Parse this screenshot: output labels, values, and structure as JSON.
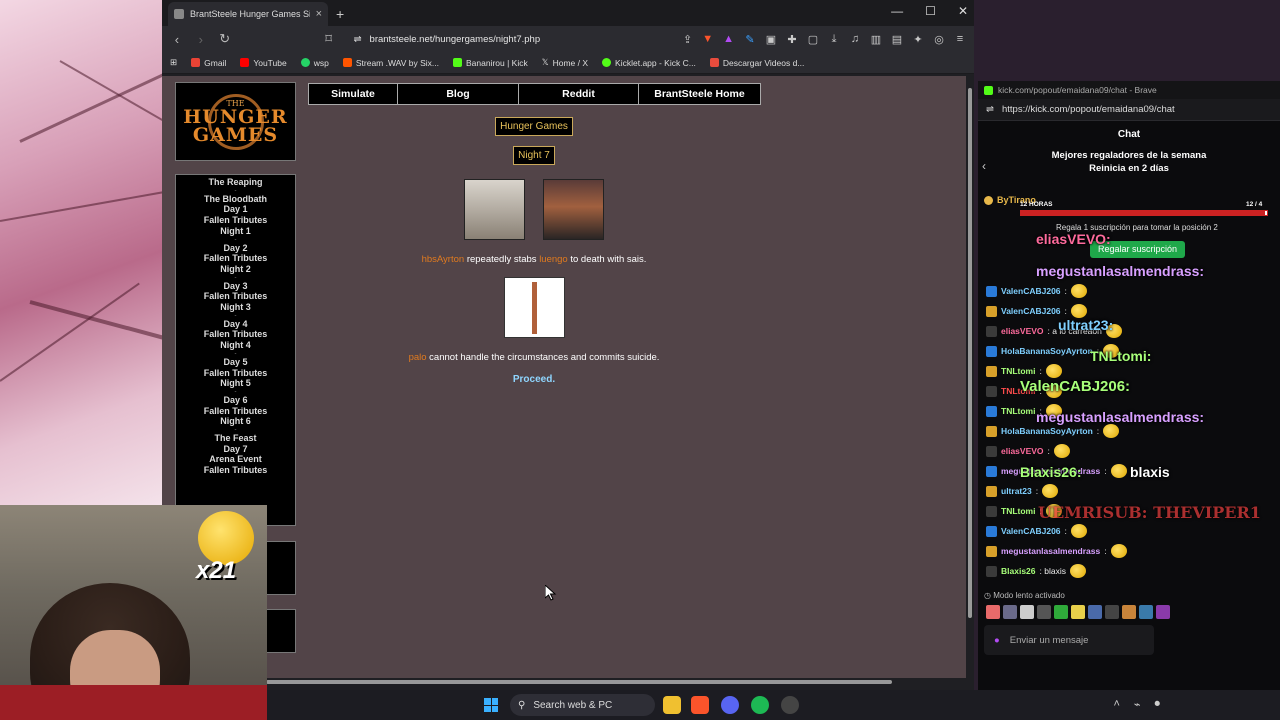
{
  "browser": {
    "tab_title": "BrantSteele Hunger Games Simu",
    "tab_close": "×",
    "new_tab": "+",
    "window_controls": [
      "—",
      "☐",
      "✕"
    ],
    "url": "brantsteele.net/hungergames/night7.php",
    "bookmarks": [
      {
        "label": "Gmail",
        "color": "#ea4335"
      },
      {
        "label": "YouTube",
        "color": "#ff0000"
      },
      {
        "label": "wsp",
        "color": "#25d366"
      },
      {
        "label": "Stream .WAV by Six...",
        "color": "#ff5500"
      },
      {
        "label": "Bananirou | Kick",
        "color": "#53fc18"
      },
      {
        "label": "Home / X",
        "color": "#ffffff"
      },
      {
        "label": "Kicklet.app - Kick C...",
        "color": "#53fc18"
      },
      {
        "label": "Descargar Videos d...",
        "color": "#e84c3d"
      }
    ]
  },
  "site": {
    "logo_line1": "THE",
    "logo_line2": "HUNGER",
    "logo_line3": "GAMES",
    "nav": [
      "Simulate",
      "Blog",
      "Reddit",
      "BrantSteele Home"
    ],
    "sidebar": [
      "The Reaping",
      "The Bloodbath",
      "Day 1",
      "Fallen Tributes",
      "Night 1",
      "Day 2",
      "Fallen Tributes",
      "Night 2",
      "Day 3",
      "Fallen Tributes",
      "Night 3",
      "Day 4",
      "Fallen Tributes",
      "Night 4",
      "Day 5",
      "Fallen Tributes",
      "Night 5",
      "Day 6",
      "Fallen Tributes",
      "Night 6",
      "The Feast",
      "Day 7",
      "Arena Event",
      "Fallen Tributes"
    ],
    "game_title": "Hunger Games",
    "phase_title": "Night 7",
    "event1": {
      "killer": "hbsAyrton",
      "action": " repeatedly stabs ",
      "victim": "luengo",
      "rest": " to death with sais."
    },
    "event2": {
      "name": "palo",
      "rest": " cannot handle the circumstances and commits suicide."
    },
    "proceed": "Proceed."
  },
  "chat": {
    "window_title": "kick.com/popout/emaidana09/chat - Brave",
    "url": "https://kick.com/popout/emaidana09/chat",
    "header": "Chat",
    "gifters_title": "Mejores regaladores de la semana",
    "gifters_reset": "Reinicia en 2 días",
    "top_user": "ByTirano",
    "timer": "12 HORAS",
    "progress_label": "12 / 4",
    "progress_value": 0.99,
    "gift_prompt": "Regala 1 suscripción para tomar la posición 2",
    "gift_button": "Regalar suscripción",
    "messages": [
      {
        "user": "ValenCABJ206",
        "color": "#7fd0ff",
        "text": ":"
      },
      {
        "user": "ValenCABJ206",
        "color": "#7fd0ff",
        "text": ":"
      },
      {
        "user": "eliasVEVO",
        "color": "#ff6b9d",
        "text": ": a lo carreaon"
      },
      {
        "user": "HolaBananaSoyAyrton",
        "color": "#7fd0ff",
        "text": ":"
      },
      {
        "user": "TNLtomi",
        "color": "#a8ff7a",
        "text": ":"
      },
      {
        "user": "TNLtomi",
        "color": "#ff4d4d",
        "text": ":"
      },
      {
        "user": "TNLtomi",
        "color": "#a8ff7a",
        "text": ":"
      },
      {
        "user": "HolaBananaSoyAyrton",
        "color": "#7fd0ff",
        "text": ":"
      },
      {
        "user": "eliasVEVO",
        "color": "#ff6b9d",
        "text": ":"
      },
      {
        "user": "megustanlasalmendrass",
        "color": "#d8a0ff",
        "text": ":"
      },
      {
        "user": "ultrat23",
        "color": "#7fd0ff",
        "text": ":"
      },
      {
        "user": "TNLtomi",
        "color": "#a8ff7a",
        "text": ":"
      },
      {
        "user": "ValenCABJ206",
        "color": "#7fd0ff",
        "text": ":"
      },
      {
        "user": "megustanlasalmendrass",
        "color": "#d8a0ff",
        "text": ":"
      },
      {
        "user": "Blaxis26",
        "color": "#a8ff7a",
        "text": ": blaxis"
      }
    ],
    "overlay_names": [
      "eliasVEVO:",
      "megustanlasalmendrass:",
      "ultrat23:",
      "TNLtomi:",
      "ValenCABJ206:",
      "megustanlasalmendrass:",
      "Blaxis26:",
      "blaxis",
      "UEMRISUB: THEVIPER1"
    ],
    "slow_mode": "Modo lento activado",
    "input_placeholder": "Enviar un mensaje"
  },
  "webcam": {
    "badge": "x21"
  },
  "taskbar": {
    "search": "Search web & PC"
  }
}
